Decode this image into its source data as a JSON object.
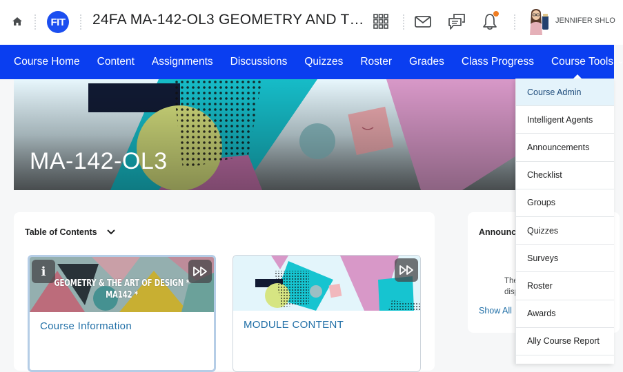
{
  "header": {
    "logo_text": "FIT",
    "course_title": "24FA MA-142-OL3 GEOMETRY AND T…",
    "user_name": "JENNIFER SHLO",
    "icons": [
      "home-icon",
      "waffle-grid-icon",
      "mail-icon",
      "chat-icon",
      "bell-icon"
    ],
    "notification_dot_color": "#ef7d22"
  },
  "nav": {
    "items": [
      {
        "label": "Course Home"
      },
      {
        "label": "Content"
      },
      {
        "label": "Assignments"
      },
      {
        "label": "Discussions"
      },
      {
        "label": "Quizzes"
      },
      {
        "label": "Roster"
      },
      {
        "label": "Grades"
      },
      {
        "label": "Class Progress"
      },
      {
        "label": "Course Tools",
        "has_dropdown": true
      }
    ],
    "background_color": "#0a3ef0"
  },
  "banner": {
    "title": "MA-142-OL3"
  },
  "toc": {
    "header": "Table of Contents",
    "cards": [
      {
        "title": "Course Information",
        "image_text_line1": "GEOMETRY & THE ART OF DESIGN *",
        "image_text_line2": "MA142 *",
        "info_label": "i"
      },
      {
        "title": "MODULE CONTENT"
      }
    ]
  },
  "announcements": {
    "title": "Announc",
    "empty_text_line1": "There",
    "empty_text_line2": "displa",
    "show_all": "Show All"
  },
  "course_tools_menu": {
    "items": [
      {
        "label": "Course Admin",
        "active": true
      },
      {
        "label": "Intelligent Agents"
      },
      {
        "label": "Announcements"
      },
      {
        "label": "Checklist"
      },
      {
        "label": "Groups"
      },
      {
        "label": "Quizzes"
      },
      {
        "label": "Surveys"
      },
      {
        "label": "Roster"
      },
      {
        "label": "Awards"
      },
      {
        "label": "Ally Course Report"
      }
    ]
  },
  "colors": {
    "link": "#1f6ea6",
    "menu_active_bg": "#e4f3fb"
  }
}
